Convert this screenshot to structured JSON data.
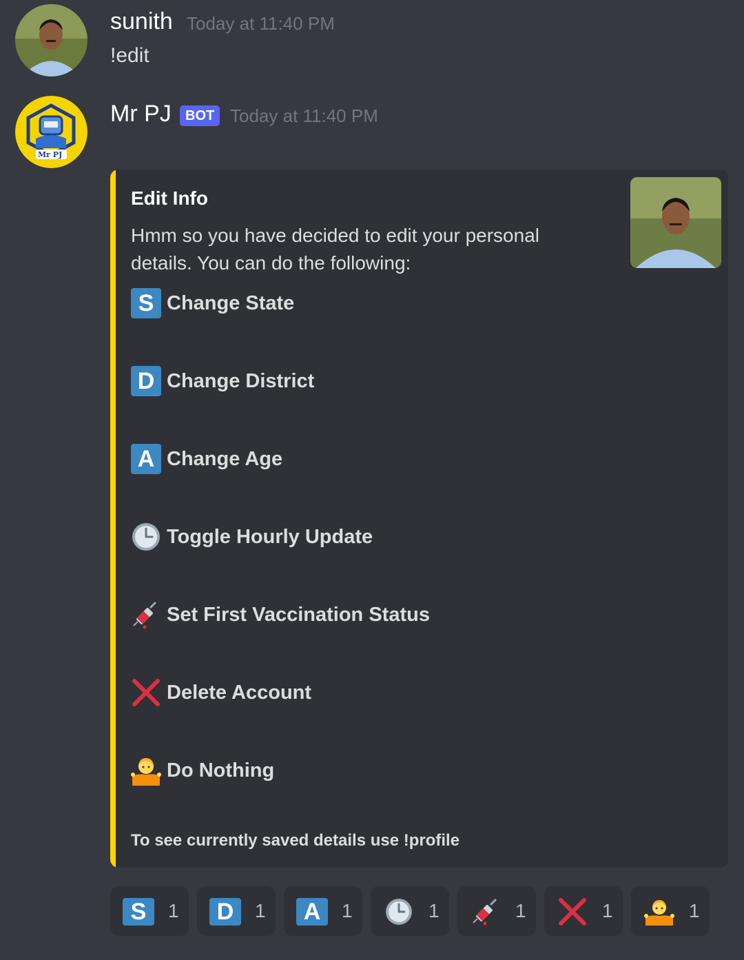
{
  "messages": {
    "user": {
      "name": "sunith",
      "timestamp": "Today at 11:40 PM",
      "text": "!edit"
    },
    "bot": {
      "name": "Mr PJ",
      "tag": "BOT",
      "timestamp": "Today at 11:40 PM",
      "avatar_text": "Mr PJ"
    }
  },
  "embed": {
    "accent_color": "#ffd400",
    "title": "Edit Info",
    "description": "Hmm so you have decided to edit your personal details. You can do the following:",
    "options": [
      {
        "icon": "regional-indicator-s",
        "key": "S",
        "label": "Change State"
      },
      {
        "icon": "regional-indicator-d",
        "key": "D",
        "label": "Change District"
      },
      {
        "icon": "regional-indicator-a",
        "key": "A",
        "label": "Change Age"
      },
      {
        "icon": "clock-icon",
        "label": "Toggle Hourly Update"
      },
      {
        "icon": "syringe-icon",
        "label": "Set First Vaccination Status"
      },
      {
        "icon": "cross-mark-icon",
        "label": "Delete Account"
      },
      {
        "icon": "shrug-icon",
        "label": "Do Nothing"
      }
    ],
    "footer": "To see currently saved details use !profile"
  },
  "reactions": [
    {
      "icon": "regional-indicator-s",
      "key": "S",
      "count": "1"
    },
    {
      "icon": "regional-indicator-d",
      "key": "D",
      "count": "1"
    },
    {
      "icon": "regional-indicator-a",
      "key": "A",
      "count": "1"
    },
    {
      "icon": "clock-icon",
      "count": "1"
    },
    {
      "icon": "syringe-icon",
      "count": "1"
    },
    {
      "icon": "cross-mark-icon",
      "count": "1"
    },
    {
      "icon": "shrug-icon",
      "count": "1"
    }
  ],
  "colors": {
    "background": "#36393f",
    "embed_background": "#2f3136",
    "bot_tag": "#5865f2",
    "key_blue": "#3b88c3"
  }
}
